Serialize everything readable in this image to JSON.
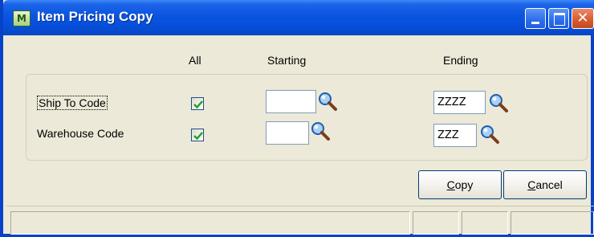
{
  "window": {
    "title": "Item Pricing Copy",
    "icon_glyph": "M"
  },
  "columns": {
    "all": "All",
    "starting": "Starting",
    "ending": "Ending"
  },
  "rows": [
    {
      "label": "Ship To Code",
      "all_checked": true,
      "starting": "",
      "ending": "ZZZZ"
    },
    {
      "label": "Warehouse Code",
      "all_checked": true,
      "starting": "",
      "ending": "ZZZ"
    }
  ],
  "buttons": {
    "copy": "Copy",
    "cancel": "Cancel"
  },
  "colors": {
    "titlebar": "#0a55e0",
    "window_bg": "#ece9d8",
    "check_green": "#21a121",
    "close_red": "#d65a2e"
  },
  "icons": {
    "title_icon": "app-icon",
    "lookup": "magnifier-icon",
    "checkbox": "checkmark-icon"
  }
}
